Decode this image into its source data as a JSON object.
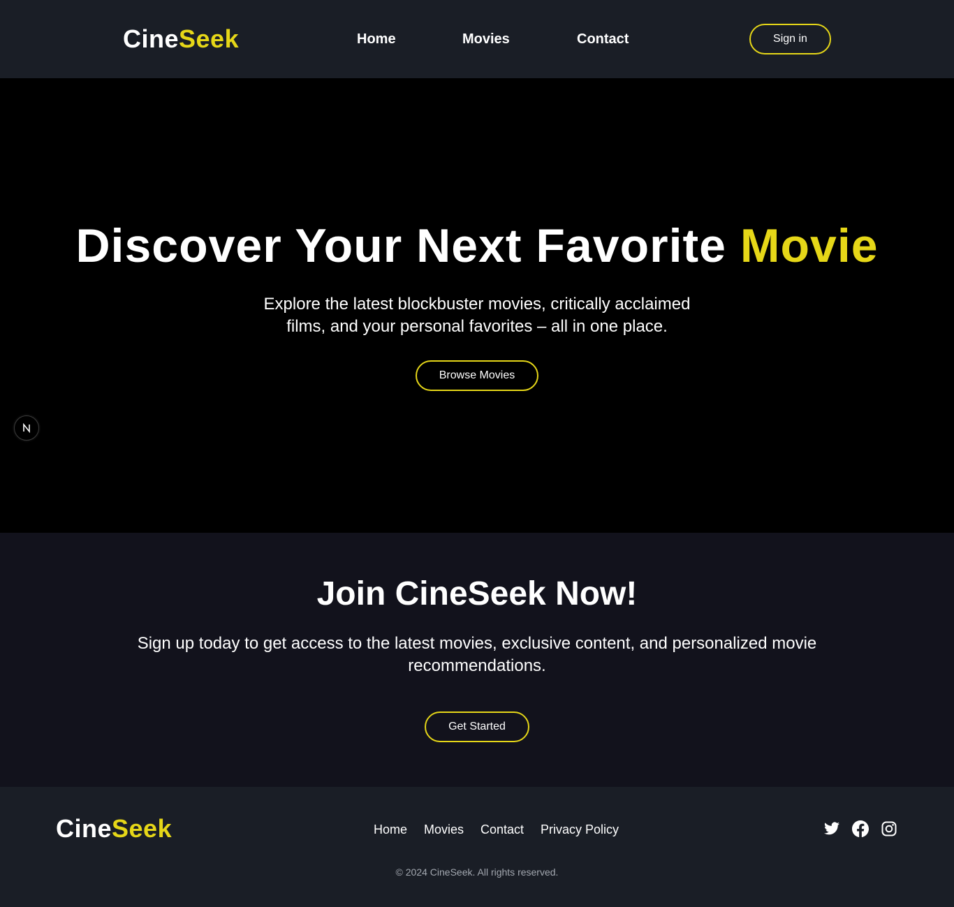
{
  "header": {
    "logo": {
      "part1": "Cine",
      "part2": "Seek"
    },
    "nav": [
      "Home",
      "Movies",
      "Contact"
    ],
    "signin_label": "Sign in"
  },
  "hero": {
    "title_main": "Discover Your Next Favorite",
    "title_accent": "Movie",
    "subtitle": "Explore the latest blockbuster movies, critically acclaimed films, and your personal favorites – all in one place.",
    "button_label": "Browse Movies",
    "badge_letter": "N"
  },
  "join": {
    "title": "Join CineSeek Now!",
    "text": "Sign up today to get access to the latest movies, exclusive content, and personalized movie recommendations.",
    "button_label": "Get Started"
  },
  "footer": {
    "logo": {
      "part1": "Cine",
      "part2": "Seek"
    },
    "links": [
      "Home",
      "Movies",
      "Contact",
      "Privacy Policy"
    ],
    "social_icons": [
      "twitter-icon",
      "facebook-icon",
      "instagram-icon"
    ],
    "copyright": "© 2024 CineSeek. All rights reserved."
  },
  "colors": {
    "accent": "#e6d718",
    "header_bg": "#1a1e26",
    "hero_bg": "#000000",
    "join_bg": "#12121c",
    "muted_text": "#a3a8b0"
  }
}
